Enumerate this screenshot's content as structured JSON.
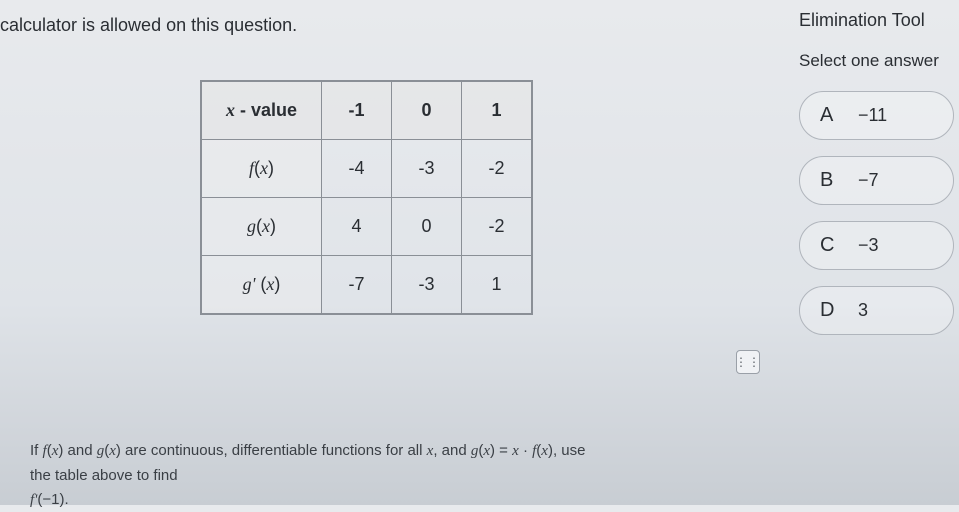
{
  "header": {
    "calc_note": " calculator is allowed on this question."
  },
  "table": {
    "rows": [
      {
        "label": "x - value",
        "label_html": "<span class='ital'>x</span> - value",
        "cells": [
          "-1",
          "0",
          "1"
        ]
      },
      {
        "label": "f(x)",
        "label_html": "<span class='ital'>f</span>(<span class='ital'>x</span>)",
        "cells": [
          "-4",
          "-3",
          "-2"
        ]
      },
      {
        "label": "g(x)",
        "label_html": "<span class='ital'>g</span>(<span class='ital'>x</span>)",
        "cells": [
          "4",
          "0",
          "-2"
        ]
      },
      {
        "label": "g'(x)",
        "label_html": "<span class='ital'>g'</span> (<span class='ital'>x</span>)",
        "cells": [
          "-7",
          "-3",
          "1"
        ]
      }
    ]
  },
  "question": {
    "line1": "If f(x) and g(x) are continuous, differentiable functions for all x, and g(x) = x · f(x), use",
    "line2": "the table above to find",
    "line3": "f'(−1)."
  },
  "right": {
    "title": "Elimination Tool",
    "select": "Select one answer",
    "answers": [
      {
        "letter": "A",
        "value": "−11"
      },
      {
        "letter": "B",
        "value": "−7"
      },
      {
        "letter": "C",
        "value": "−3"
      },
      {
        "letter": "D",
        "value": "3"
      }
    ]
  },
  "handle_glyph": "⋮⋮"
}
